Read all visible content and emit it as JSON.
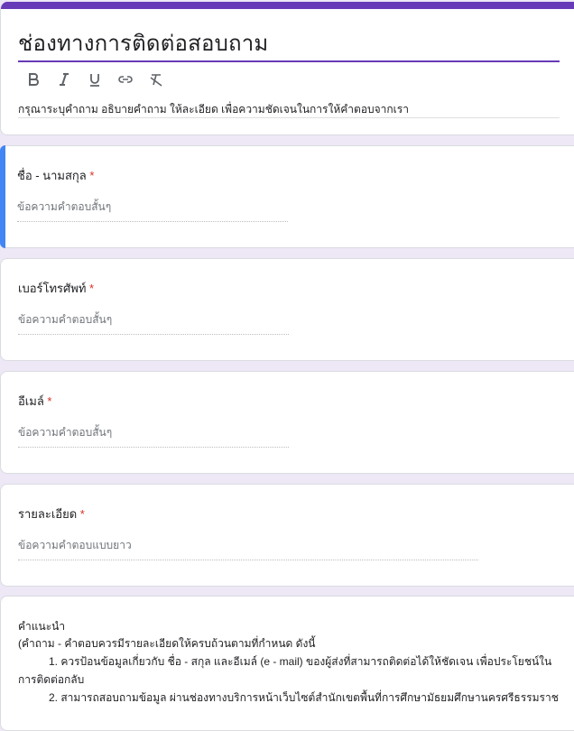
{
  "form": {
    "title": "ช่องทางการติดต่อสอบถาม",
    "description": "กรุณาระบุคำถาม อธิบายคำถาม ให้ละเอียด เพื่อความชัดเจนในการให้คำตอบจากเรา",
    "toolbar": [
      {
        "name": "bold-icon",
        "glyph": "B"
      },
      {
        "name": "italic-icon",
        "glyph": "I"
      },
      {
        "name": "underline-icon",
        "glyph": "U"
      },
      {
        "name": "link-icon",
        "glyph": "link"
      },
      {
        "name": "clear-format-icon",
        "glyph": "Tx"
      }
    ]
  },
  "questions": [
    {
      "label": "ชื่อ - นามสกุล",
      "required": "*",
      "placeholder": "ข้อความคำตอบสั้นๆ"
    },
    {
      "label": "เบอร์โทรศัพท์",
      "required": "*",
      "placeholder": "ข้อความคำตอบสั้นๆ"
    },
    {
      "label": "อีเมล์",
      "required": "*",
      "placeholder": "ข้อความคำตอบสั้นๆ"
    },
    {
      "label": "รายละเอียด",
      "required": "*",
      "placeholder": "ข้อความคำตอบแบบยาว"
    }
  ],
  "notes": {
    "heading": "คำแนะนำ",
    "line1": "(คำถาม - คำตอบควรมีรายละเอียดให้ครบถ้วนตามที่กำหนด ดังนี้",
    "line2": "1. ควรป้อนข้อมูลเกี่ยวกับ ชื่อ - สกุล และอีเมล์ (e - mail) ของผู้ส่งที่สามารถติดต่อได้ให้ชัดเจน เพื่อประโยชน์ในการติดต่อกลับ",
    "line3": "2. สามารถสอบถามข้อมูล ผ่านช่องทางบริการหน้าเว็บไซต์สำนักเขตพื้นที่การศึกษามัธยมศึกษานครศรีธรรมราช"
  }
}
